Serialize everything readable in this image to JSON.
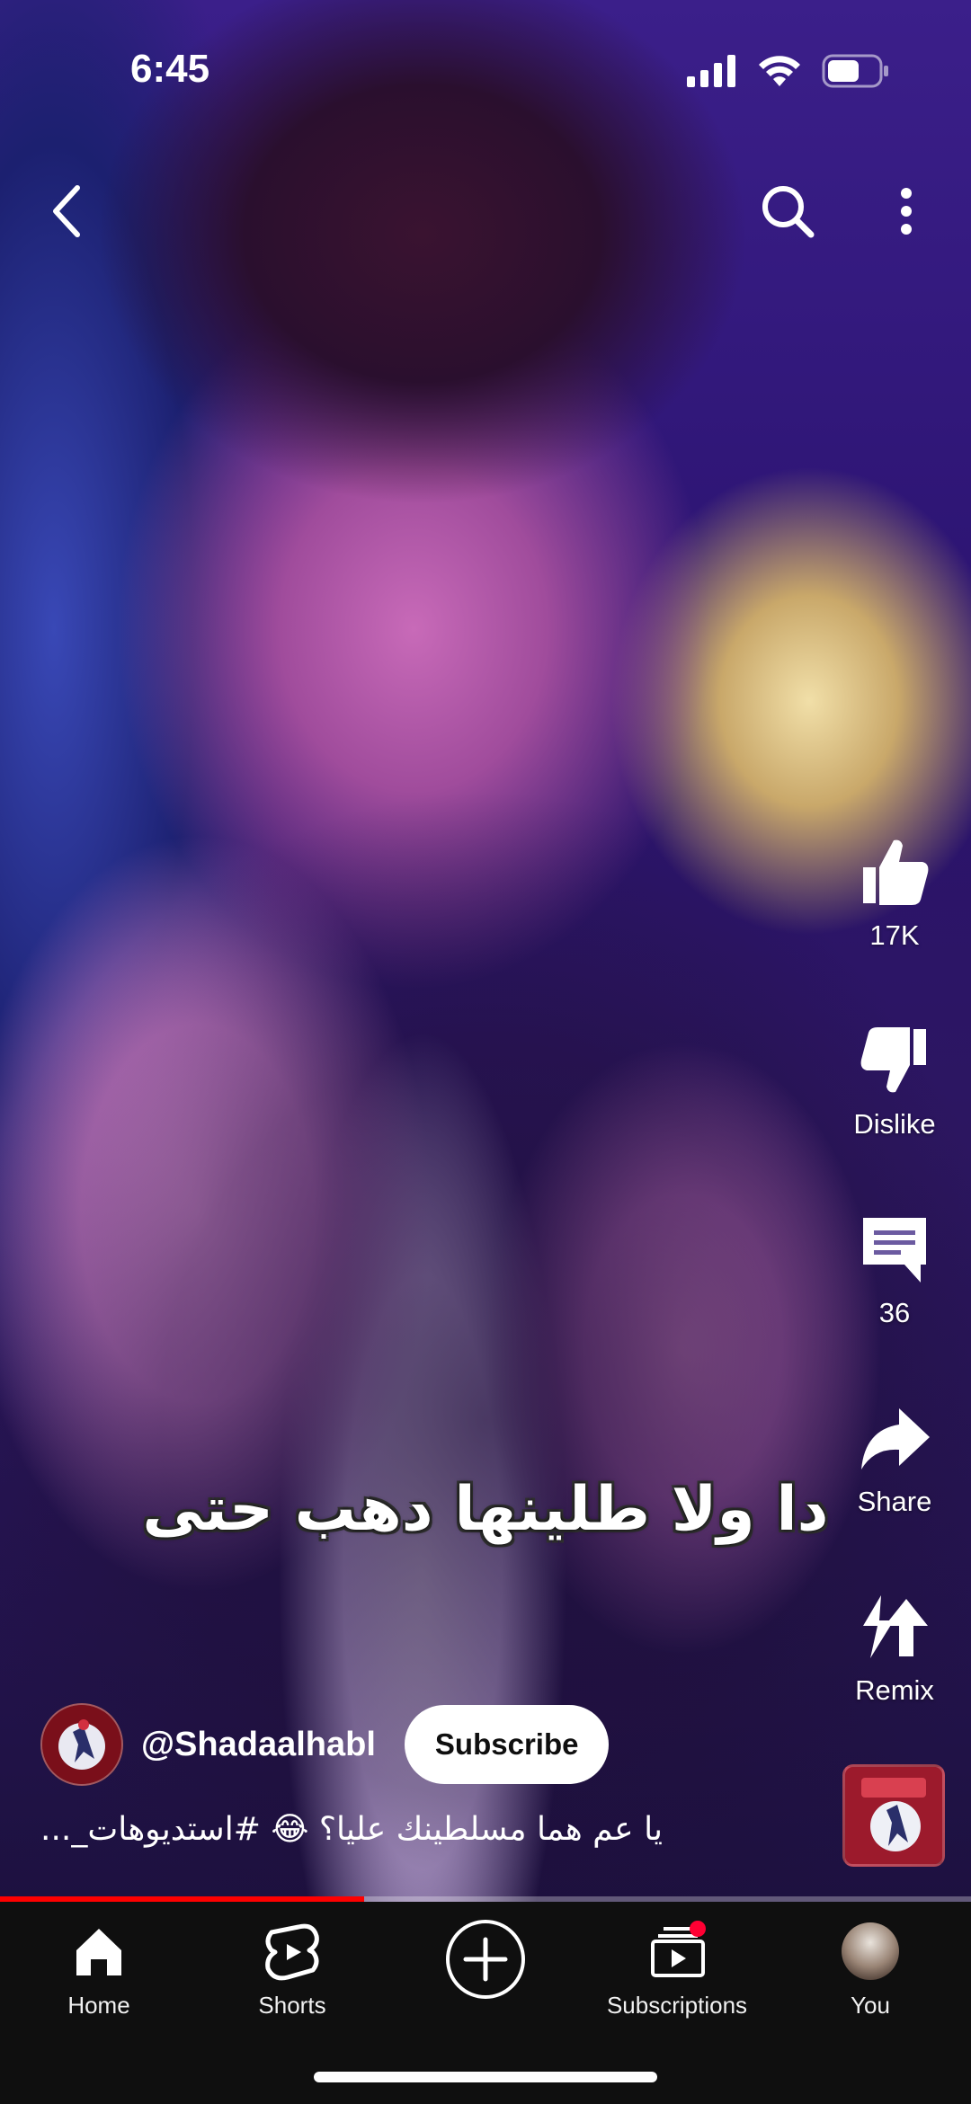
{
  "status_bar": {
    "time": "6:45"
  },
  "top_nav": {
    "back_icon": "chevron-left",
    "search_icon": "search",
    "more_icon": "more-vertical"
  },
  "video": {
    "caption_overlay": "دا ولا طلينها دهب حتى"
  },
  "actions": {
    "like": {
      "label": "17K",
      "icon": "thumbs-up"
    },
    "dislike": {
      "label": "Dislike",
      "icon": "thumbs-down"
    },
    "comments": {
      "label": "36",
      "icon": "comment"
    },
    "share": {
      "label": "Share",
      "icon": "share-arrow"
    },
    "remix": {
      "label": "Remix",
      "icon": "remix"
    }
  },
  "channel": {
    "handle": "@Shadaalhabl",
    "subscribe_label": "Subscribe"
  },
  "description": "يا عم هما مسلطينك عليا؟ 😂 #استديوهات_...",
  "progress": {
    "fraction": 0.375,
    "color": "#ff0000"
  },
  "bottom_nav": {
    "items": [
      {
        "label": "Home",
        "icon": "home"
      },
      {
        "label": "Shorts",
        "icon": "shorts"
      },
      {
        "label": "",
        "icon": "create-plus"
      },
      {
        "label": "Subscriptions",
        "icon": "subscriptions"
      },
      {
        "label": "You",
        "icon": "profile-avatar"
      }
    ]
  }
}
